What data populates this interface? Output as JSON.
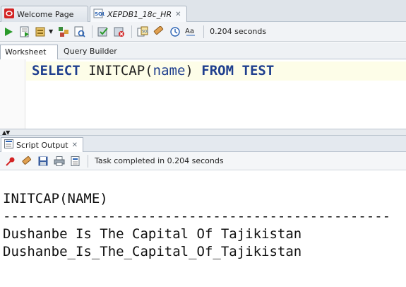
{
  "tabs": {
    "welcome_label": "Welcome Page",
    "worksheet_label": "XEPDB1_18c_HR"
  },
  "toolbar": {
    "elapsed": "0.204 seconds"
  },
  "subtabs": {
    "worksheet": "Worksheet",
    "query_builder": "Query Builder"
  },
  "editor": {
    "kw_select": "SELECT",
    "func": "INITCAP",
    "open_paren": "(",
    "arg": "name",
    "close_paren": ")",
    "kw_from": "FROM",
    "table": "TEST"
  },
  "output_panel": {
    "tab_label": "Script Output",
    "status": "Task completed in 0.204 seconds",
    "lines": {
      "header": "INITCAP(NAME)",
      "divider": "------------------------------------------------",
      "row1": "Dushanbe Is The Capital Of Tajikistan",
      "row2": "Dushanbe_Is_The_Capital_Of_Tajikistan"
    }
  },
  "icons": [
    "oracle-icon",
    "sql-icon",
    "run-statement-icon",
    "run-script-icon",
    "autotrace-icon",
    "explain-plan-icon",
    "sql-tuning-icon",
    "commit-icon",
    "rollback-icon",
    "unshared-sql-icon",
    "clear-icon",
    "history-icon",
    "format-case-icon",
    "pin-icon",
    "eraser-icon",
    "save-icon",
    "print-icon",
    "open-file-icon"
  ],
  "colors": {
    "keyword": "#1f3f8e",
    "run_green": "#2a9a2a",
    "oracle_red": "#d32424"
  }
}
